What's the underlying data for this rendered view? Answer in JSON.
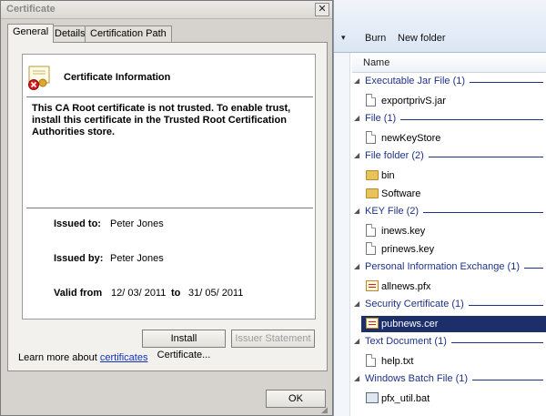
{
  "dialog": {
    "title": "Certificate",
    "close_glyph": "✕",
    "tabs": [
      {
        "label": "General",
        "active": true
      },
      {
        "label": "Details",
        "active": false
      },
      {
        "label": "Certification Path",
        "active": false
      }
    ],
    "info_title": "Certificate Information",
    "warning_text": "This CA Root certificate is not trusted. To enable trust, install this certificate in the Trusted Root Certification Authorities store.",
    "issued_to_label": "Issued to:",
    "issued_to": "Peter Jones",
    "issued_by_label": "Issued by:",
    "issued_by": "Peter Jones",
    "valid_from_label": "Valid from",
    "valid_from": "12/ 03/ 2011",
    "valid_to_label": "to",
    "valid_to": "31/ 05/ 2011",
    "install_button": "Install Certificate...",
    "issuer_button": "Issuer Statement",
    "learn_more_prefix": "Learn more about ",
    "learn_more_link": "certificates",
    "ok_button": "OK"
  },
  "explorer": {
    "toolbar": {
      "arrow": "▾",
      "burn": "Burn",
      "new_folder": "New folder"
    },
    "column_name": "Name",
    "groups": [
      {
        "title": "Executable Jar File (1)",
        "items": [
          {
            "name": "exportprivS.jar",
            "icon": "document-icon"
          }
        ]
      },
      {
        "title": "File (1)",
        "items": [
          {
            "name": "newKeyStore",
            "icon": "document-icon"
          }
        ]
      },
      {
        "title": "File folder (2)",
        "items": [
          {
            "name": "bin",
            "icon": "folder-icon"
          },
          {
            "name": "Software",
            "icon": "folder-icon"
          }
        ]
      },
      {
        "title": "KEY File (2)",
        "items": [
          {
            "name": "inews.key",
            "icon": "document-icon"
          },
          {
            "name": "prinews.key",
            "icon": "document-icon"
          }
        ]
      },
      {
        "title": "Personal Information Exchange (1)",
        "items": [
          {
            "name": "allnews.pfx",
            "icon": "pfx-icon"
          }
        ]
      },
      {
        "title": "Security Certificate (1)",
        "items": [
          {
            "name": "pubnews.cer",
            "icon": "certificate-icon",
            "selected": true
          }
        ]
      },
      {
        "title": "Text Document (1)",
        "items": [
          {
            "name": "help.txt",
            "icon": "document-icon"
          }
        ]
      },
      {
        "title": "Windows Batch File (1)",
        "items": [
          {
            "name": "pfx_util.bat",
            "icon": "batch-file-icon"
          }
        ]
      }
    ]
  },
  "colors": {
    "selection": "#1c2f6b",
    "group_header": "#1e3287",
    "link": "#1233b8",
    "dialog_face": "#d6d3ce"
  }
}
